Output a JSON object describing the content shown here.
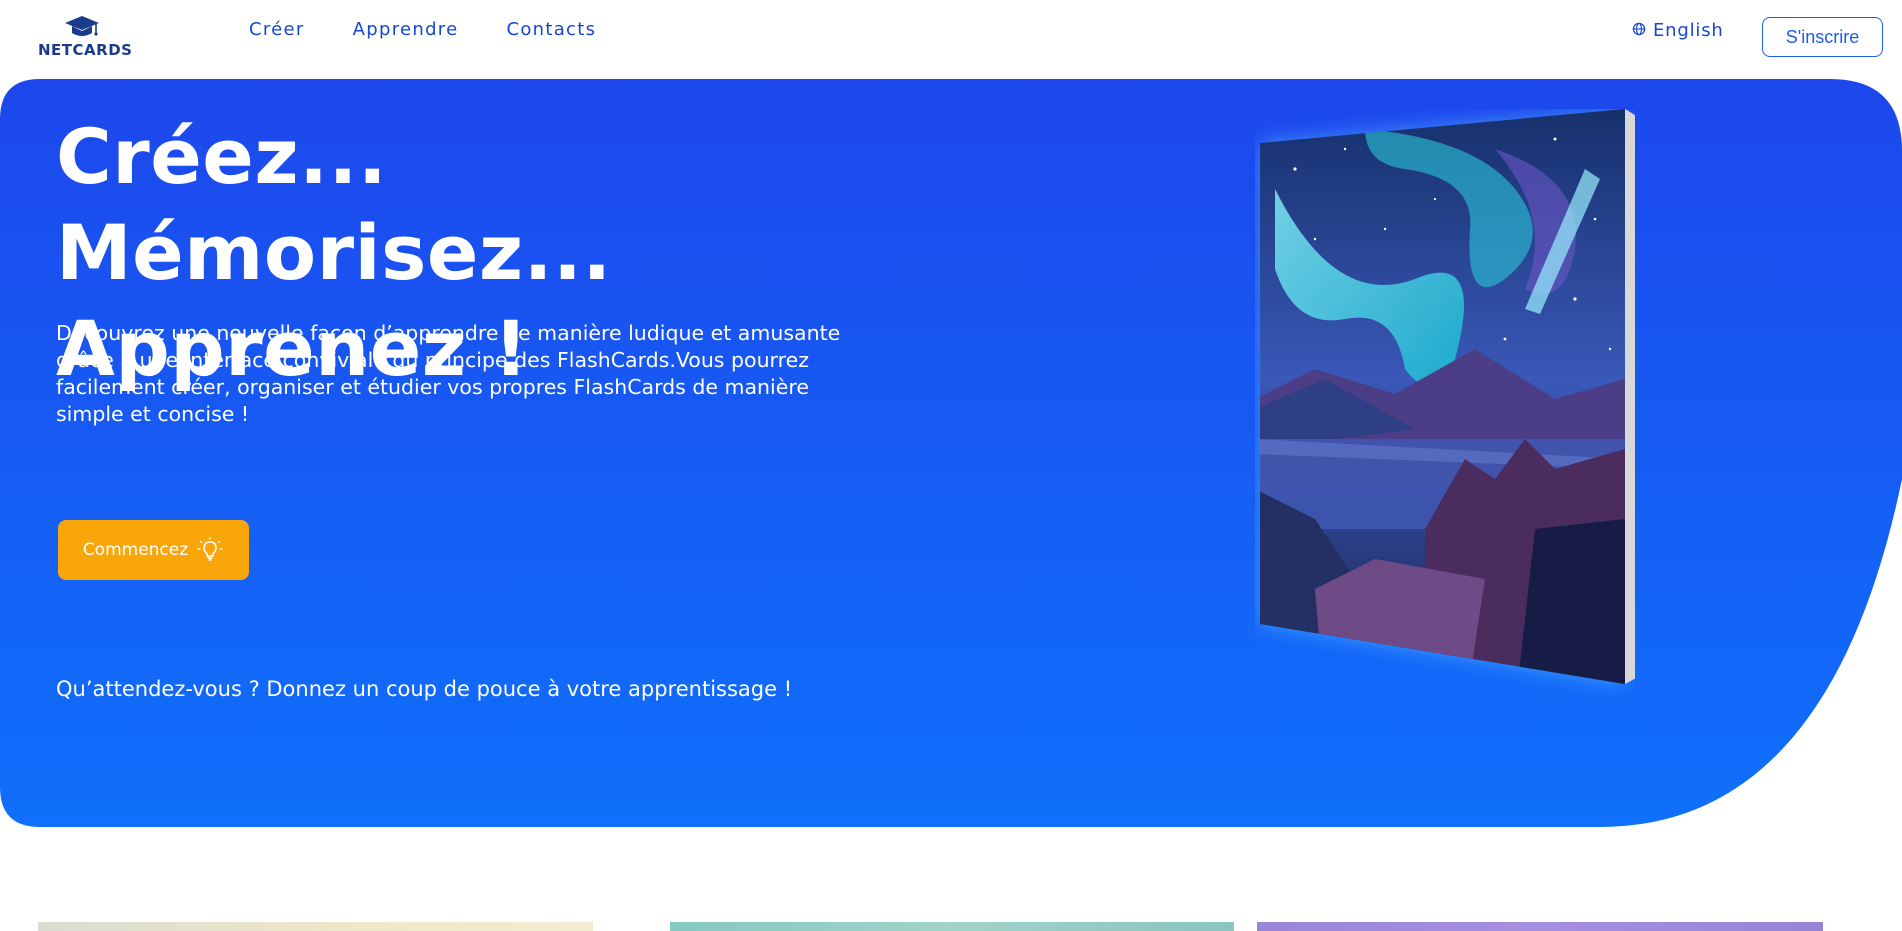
{
  "header": {
    "logo_text": "NETCARDS",
    "nav": [
      {
        "label": "Créer"
      },
      {
        "label": "Apprendre"
      },
      {
        "label": "Contacts"
      }
    ],
    "language": {
      "label": "English",
      "icon": "globe-icon"
    },
    "signup_label": "S'inscrire"
  },
  "hero": {
    "title_line1": "Créez... Mémorisez...",
    "title_line2": "Apprenez !",
    "description": "Découvrez une nouvelle façon d’apprendre de manière ludique et amusante grâce à une interface conviviale du principe des FlashCards.Vous pourrez facilement créer, organiser et étudier vos propres FlashCards de manière simple et concise !",
    "cta_label": "Commencez",
    "cta_icon": "lightbulb-icon",
    "tagline": "Qu’attendez-vous ? Donnez un coup de pouce à votre apprentissage !"
  },
  "colors": {
    "hero_gradient_top": "#1d47ec",
    "hero_gradient_bottom": "#0f70fb",
    "accent": "#f9a60b",
    "nav_text": "#1646d4"
  }
}
